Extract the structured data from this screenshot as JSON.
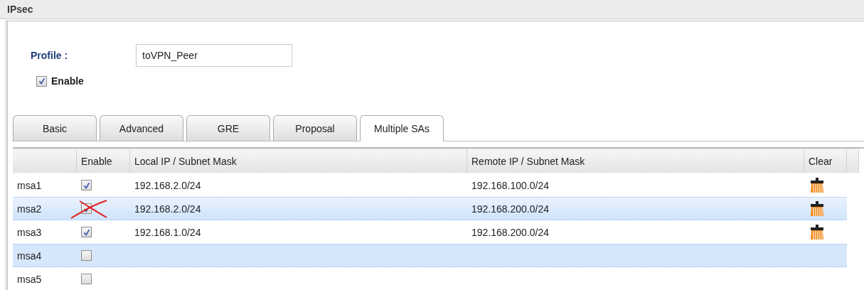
{
  "window": {
    "title": "IPsec"
  },
  "profile": {
    "label": "Profile :",
    "value": "toVPN_Peer"
  },
  "enable": {
    "label": "Enable",
    "checked": true
  },
  "tabs": [
    {
      "label": "Basic",
      "selected": false
    },
    {
      "label": "Advanced",
      "selected": false
    },
    {
      "label": "GRE",
      "selected": false
    },
    {
      "label": "Proposal",
      "selected": false
    },
    {
      "label": "Multiple SAs",
      "selected": true
    }
  ],
  "table": {
    "columns": [
      "Enable",
      "Local IP / Subnet Mask",
      "Remote IP / Subnet Mask",
      "Clear"
    ],
    "rows": [
      {
        "name": "msa1",
        "enabled": true,
        "local": "192.168.2.0/24",
        "remote": "192.168.100.0/24",
        "clearable": true,
        "hovered": false,
        "selected": false,
        "crossed_out": false
      },
      {
        "name": "msa2",
        "enabled": true,
        "local": "192.168.2.0/24",
        "remote": "192.168.200.0/24",
        "clearable": true,
        "hovered": true,
        "selected": false,
        "crossed_out": true
      },
      {
        "name": "msa3",
        "enabled": true,
        "local": "192.168.1.0/24",
        "remote": "192.168.200.0/24",
        "clearable": true,
        "hovered": false,
        "selected": false,
        "crossed_out": false
      },
      {
        "name": "msa4",
        "enabled": false,
        "clearable": false,
        "hovered": false,
        "selected": true,
        "crossed_out": false
      },
      {
        "name": "msa5",
        "enabled": false,
        "clearable": false,
        "hovered": false,
        "selected": false,
        "crossed_out": false
      }
    ]
  }
}
